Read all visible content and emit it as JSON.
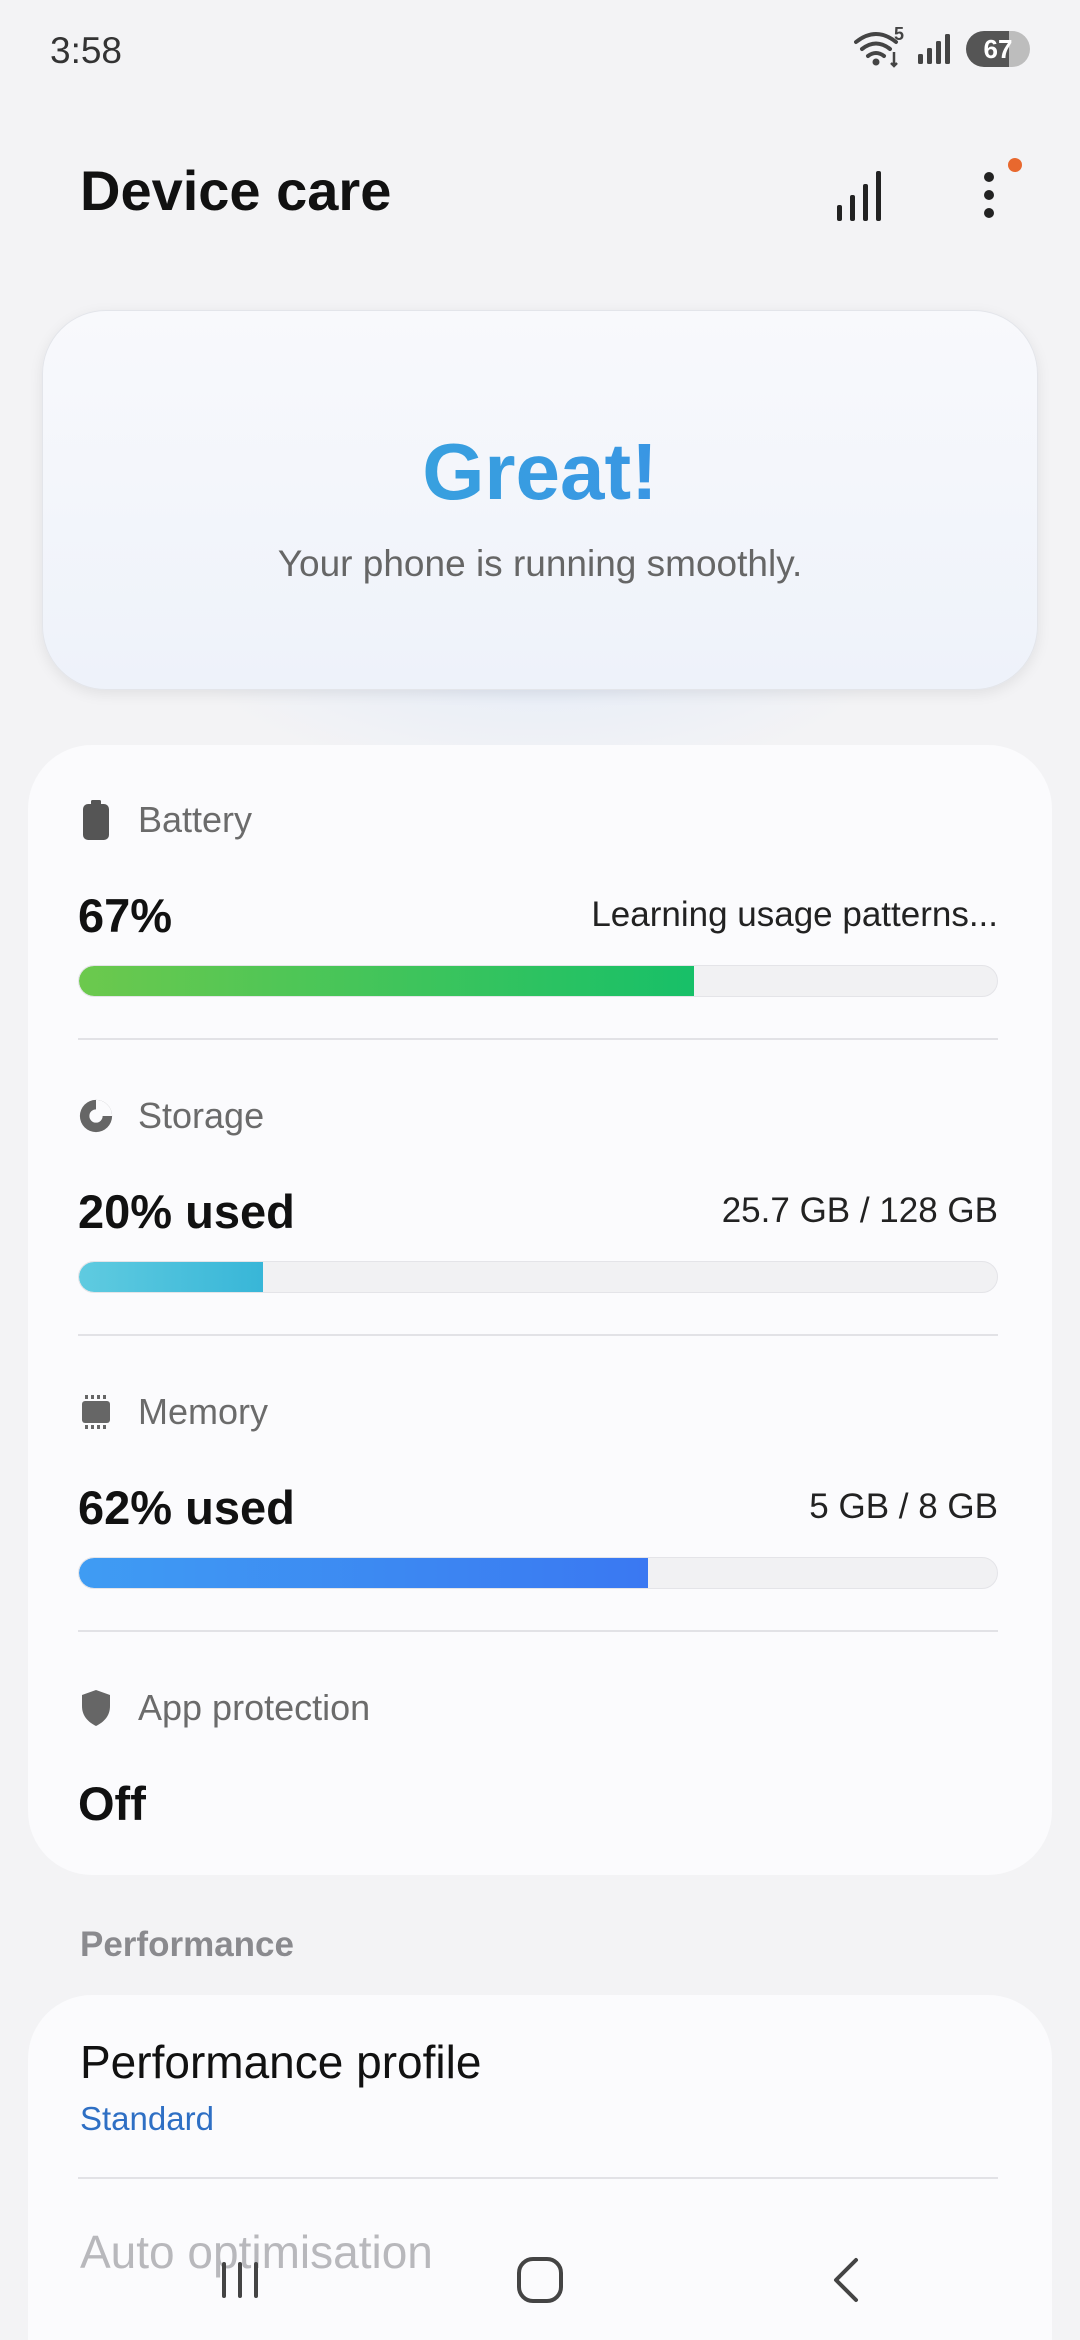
{
  "status_bar": {
    "time": "3:58",
    "battery_level": "67",
    "wifi_badge": "5"
  },
  "header": {
    "title": "Device care",
    "actions": [
      "bar-chart-icon",
      "more-options-icon"
    ]
  },
  "hero": {
    "title": "Great!",
    "subtitle": "Your phone is running smoothly."
  },
  "stats": {
    "battery": {
      "label": "Battery",
      "value": "67%",
      "detail": "Learning usage patterns...",
      "fraction": 0.67,
      "color_start": "#6cc94d",
      "color_end": "#17c068",
      "icon": "battery-icon"
    },
    "storage": {
      "label": "Storage",
      "value": "20% used",
      "detail": "25.7 GB / 128 GB",
      "fraction": 0.2,
      "color_start": "#5fcbe0",
      "color_end": "#38b6d8",
      "icon": "pie-chart-icon"
    },
    "memory": {
      "label": "Memory",
      "value": "62% used",
      "detail": "5 GB / 8 GB",
      "fraction": 0.62,
      "color_start": "#3f9cf3",
      "color_end": "#3a78f2",
      "icon": "memory-chip-icon"
    },
    "app_protection": {
      "label": "App protection",
      "value": "Off",
      "icon": "shield-icon"
    }
  },
  "performance": {
    "section_title": "Performance",
    "profile_title": "Performance profile",
    "profile_value": "Standard",
    "auto_optimisation": "Auto optimisation"
  },
  "nav": {
    "buttons": [
      "recent-apps-icon",
      "home-icon",
      "back-icon"
    ]
  }
}
